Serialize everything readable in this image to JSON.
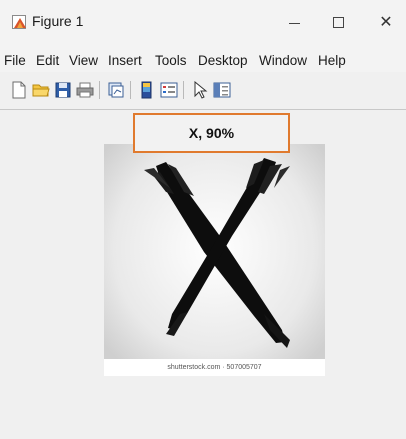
{
  "window": {
    "title": "Figure 1",
    "controls": {
      "close_glyph": "✕"
    }
  },
  "menubar": {
    "items": [
      "File",
      "Edit",
      "View",
      "Insert",
      "Tools",
      "Desktop",
      "Window",
      "Help"
    ]
  },
  "toolbar": {
    "icons": [
      "new-figure-icon",
      "open-file-icon",
      "save-icon",
      "print-icon",
      "link-plot-icon",
      "colorbar-icon",
      "legend-icon",
      "pointer-icon",
      "property-inspector-icon"
    ]
  },
  "figure": {
    "title": "X, 90%",
    "title_border_color": "#e07a2e",
    "image_watermark": "shutterstock.com · 507005707"
  }
}
